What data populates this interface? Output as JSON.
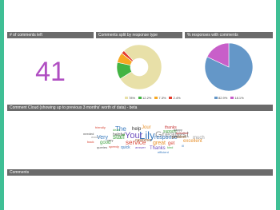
{
  "panels": {
    "comments_left": {
      "header": "# of comments left",
      "value": "41"
    },
    "response_type": {
      "header": "Comments split by response type",
      "legend": [
        {
          "label": "78%",
          "color": "#e8e0a8"
        },
        {
          "label": "12.2%",
          "color": "#43b443"
        },
        {
          "label": "7.3%",
          "color": "#f7a823"
        },
        {
          "label": "2.4%",
          "color": "#e43d2c"
        }
      ],
      "chart_data": {
        "type": "pie",
        "categories": [
          "",
          "",
          "",
          ""
        ],
        "values": [
          78,
          12.2,
          7.3,
          2.4
        ]
      }
    },
    "with_comments": {
      "header": "% responses with comments",
      "legend": [
        {
          "label": "82.9%",
          "color": "#6497c8"
        },
        {
          "label": "18.1%",
          "color": "#c85fc9"
        }
      ],
      "chart_data": {
        "type": "pie",
        "categories": [
          "",
          ""
        ],
        "values": [
          82.9,
          18.1
        ]
      }
    },
    "cloud": {
      "header": "Comment Cloud (showing up to previous 3 months' worth of data) - beta",
      "words": [
        "The",
        "help",
        "Jour",
        "thanks",
        "Lily",
        "Your",
        "Greatest",
        "great",
        "response",
        "service",
        "friendly",
        "helpful",
        "good",
        "Thanks",
        "get",
        "problem",
        "quick",
        "Very",
        "staff",
        "customer",
        "support",
        "needed",
        "would",
        "back",
        "very",
        "efficient",
        "question",
        "speedy",
        "excellent",
        "much",
        "queries",
        "kind",
        "answer",
        "ill",
        "happy",
        "dealt"
      ]
    },
    "comments": {
      "header": "Comments"
    }
  },
  "colors": {
    "accent": "#3fbf95",
    "header_bg": "#6b6b6b",
    "number": "#b04ec2"
  }
}
